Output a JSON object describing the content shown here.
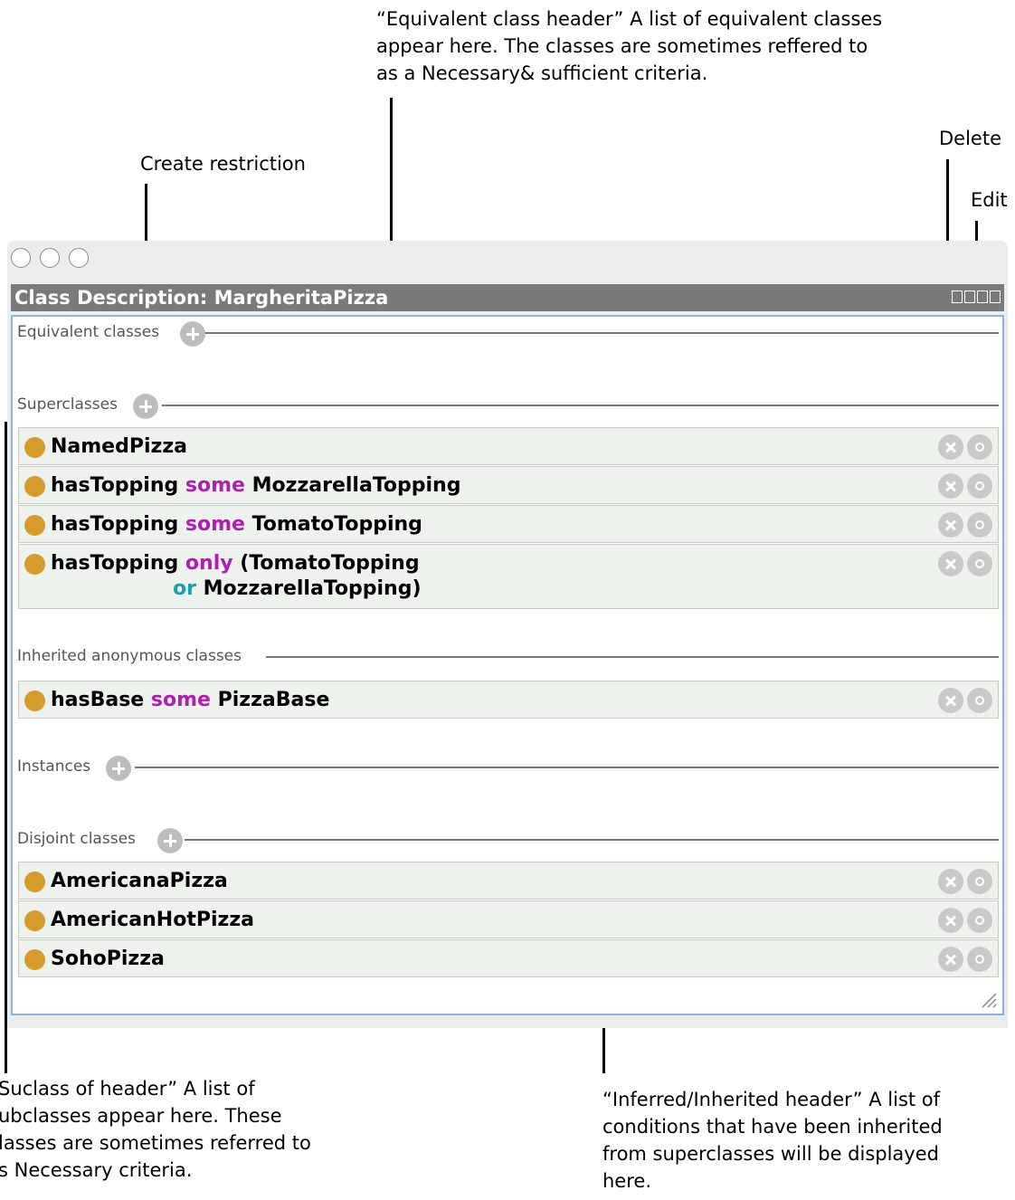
{
  "annotations": {
    "equivalent": [
      "“Equivalent class header” A list of equivalent classes",
      "appear here. The classes are sometimes reffered to",
      "as a Necessary& sufficient criteria."
    ],
    "create_restriction": "Create restriction",
    "delete": "Delete",
    "edit": "Edit",
    "subclass": [
      "Suclass of header” A list of",
      "ubclasses appear here. These",
      "lasses are sometimes referred to",
      "s Necessary criteria."
    ],
    "inherited": [
      "“Inferred/Inherited header” A list of",
      "conditions that have been inherited",
      "from superclasses will be displayed",
      "here."
    ]
  },
  "window": {
    "title": "Class Description: MargheritaPizza"
  },
  "sections": {
    "equivalent": "Equivalent classes",
    "superclasses": "Superclasses",
    "inherited": "Inherited anonymous classes",
    "instances": "Instances",
    "disjoint": "Disjoint classes"
  },
  "superclasses": {
    "r1": {
      "name": "NamedPizza"
    },
    "r2": {
      "prop": "hasTopping",
      "kw": "some",
      "cls": "MozzarellaTopping"
    },
    "r3": {
      "prop": "hasTopping",
      "kw": "some",
      "cls": "TomatoTopping"
    },
    "r4": {
      "prop": "hasTopping",
      "kw": "only",
      "cls": "(TomatoTopping",
      "kw2": "or",
      "cls2": "MozzarellaTopping)"
    }
  },
  "inherited": {
    "r1": {
      "prop": "hasBase",
      "kw": "some",
      "cls": "PizzaBase"
    }
  },
  "disjoint": {
    "r1": "AmericanaPizza",
    "r2": "AmericanHotPizza",
    "r3": "SohoPizza"
  },
  "colors": {
    "keyword_some_only": "#b020b0",
    "keyword_or": "#18a0b0",
    "class_dot": "#d39c2c",
    "header_bg": "#7a7a7a",
    "panel_border": "#8ab3d8"
  },
  "icons": [
    "plus-icon",
    "delete-icon",
    "edit-icon",
    "class-dot-icon",
    "resize-grip-icon"
  ]
}
